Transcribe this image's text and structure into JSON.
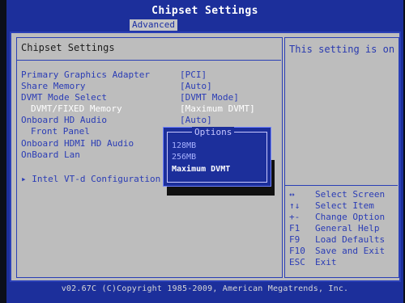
{
  "window": {
    "title": "Chipset Settings",
    "tab_active": "Advanced"
  },
  "section": {
    "title": "Chipset Settings"
  },
  "help": {
    "text": "This setting is only"
  },
  "items": [
    {
      "label": "Primary Graphics Adapter",
      "value": "[PCI]",
      "highlighted": false
    },
    {
      "label": "Share Memory",
      "value": "[Auto]",
      "highlighted": false
    },
    {
      "label": "DVMT Mode Select",
      "value": "[DVMT Mode]",
      "highlighted": false
    },
    {
      "label": "DVMT/FIXED Memory",
      "value": "[Maximum DVMT]",
      "highlighted": true
    },
    {
      "label": "Onboard HD Audio",
      "value": "[Auto]",
      "highlighted": false
    },
    {
      "label": "Front Panel",
      "value": "",
      "highlighted": false
    },
    {
      "label": "Onboard HDMI HD Audio",
      "value": "",
      "highlighted": false
    },
    {
      "label": "OnBoard Lan",
      "value": "",
      "highlighted": false
    }
  ],
  "submenu": {
    "arrow": "▸",
    "label": "Intel VT-d Configuration"
  },
  "popup": {
    "title": "Options",
    "options": [
      "128MB",
      "256MB",
      "Maximum DVMT"
    ],
    "selected_index": 2
  },
  "keys": [
    {
      "key": "↔",
      "action": "Select Screen"
    },
    {
      "key": "↑↓",
      "action": "Select Item"
    },
    {
      "key": "+-",
      "action": "Change Option"
    },
    {
      "key": "F1",
      "action": "General Help"
    },
    {
      "key": "F9",
      "action": "Load Defaults"
    },
    {
      "key": "F10",
      "action": "Save and Exit"
    },
    {
      "key": "ESC",
      "action": "Exit"
    }
  ],
  "footer": {
    "text": "v02.67C (C)Copyright 1985-2009, American Megatrends, Inc."
  },
  "colors": {
    "bios_blue": "#1c2f9b",
    "panel_gray": "#bdbdbd",
    "item_blue": "#2a3cb5",
    "highlight_white": "#ffffff"
  }
}
